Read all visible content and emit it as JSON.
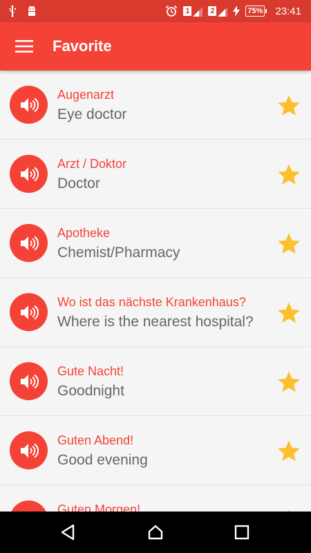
{
  "status_bar": {
    "sim1": "1",
    "sim2": "2",
    "battery": "75%",
    "time": "23:41",
    "icons": [
      "usb-icon",
      "android-debug-icon",
      "alarm-icon",
      "signal-icon",
      "charging-icon",
      "battery-icon"
    ]
  },
  "app_bar": {
    "title": "Favorite",
    "menu_icon": "hamburger-menu-icon"
  },
  "favorites": [
    {
      "german": "Augenarzt",
      "english": "Eye doctor"
    },
    {
      "german": "Arzt / Doktor",
      "english": "Doctor"
    },
    {
      "german": "Apotheke",
      "english": "Chemist/Pharmacy"
    },
    {
      "german": "Wo ist das nächste Krankenhaus?",
      "english": "Where is the nearest hospital?"
    },
    {
      "german": "Gute Nacht!",
      "english": "Goodnight"
    },
    {
      "german": "Guten Abend!",
      "english": "Good evening"
    },
    {
      "german": "Guten Morgen!",
      "english": ""
    }
  ],
  "colors": {
    "primary": "#f44336",
    "status_bar": "#d83a2e",
    "star": "#fbc02d",
    "secondary_text": "#666666"
  },
  "nav_bar": {
    "icons": [
      "back-icon",
      "home-icon",
      "recents-icon"
    ]
  }
}
